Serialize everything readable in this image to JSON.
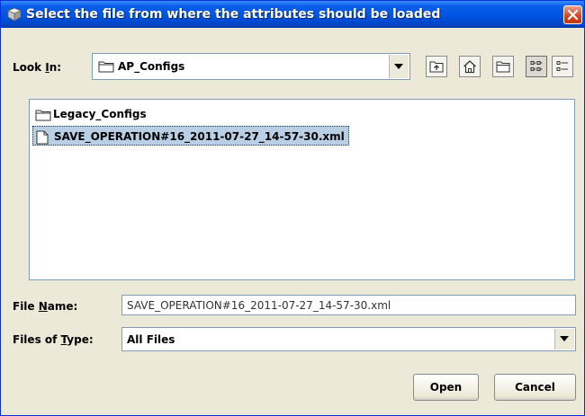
{
  "window": {
    "title": "Select the file from where the attributes should be loaded"
  },
  "lookin": {
    "label_pre": "Look ",
    "label_mnemonic": "I",
    "label_post": "n:",
    "value": "AP_Configs"
  },
  "toolbar": {
    "buttons": [
      "up-one-level",
      "home",
      "new-folder",
      "list-view",
      "details-view"
    ],
    "active": "list-view"
  },
  "files": [
    {
      "name": "Legacy_Configs",
      "type": "folder",
      "selected": false
    },
    {
      "name": "SAVE_OPERATION#16_2011-07-27_14-57-30.xml",
      "type": "file",
      "selected": true
    }
  ],
  "file_name": {
    "label_pre": "File ",
    "label_mnemonic": "N",
    "label_post": "ame:",
    "value": "SAVE_OPERATION#16_2011-07-27_14-57-30.xml"
  },
  "file_type": {
    "label_pre": "Files of ",
    "label_mnemonic": "T",
    "label_post": "ype:",
    "value": "All Files"
  },
  "buttons": {
    "open": "Open",
    "cancel": "Cancel"
  }
}
